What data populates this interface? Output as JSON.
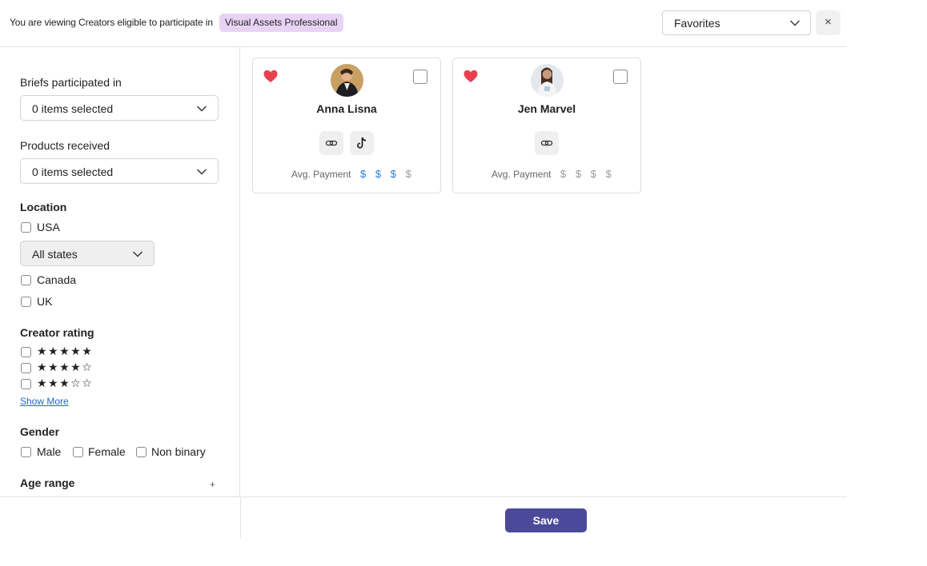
{
  "header": {
    "viewing_text": "You are viewing Creators eligible to participate in",
    "brief_pill": "Visual Assets Professional",
    "list_select_value": "Favorites",
    "close_symbol": "×",
    "pill_color": "#e9d3f5"
  },
  "filters": {
    "briefs": {
      "label": "Briefs participated in",
      "value": "0 items selected"
    },
    "products": {
      "label": "Products received",
      "value": "0 items selected"
    },
    "location": {
      "title": "Location",
      "usa": "USA",
      "states_value": "All states",
      "canada": "Canada",
      "uk": "UK"
    },
    "rating": {
      "title": "Creator rating",
      "rows": [
        {
          "stars": "★★★★★",
          "value": 5
        },
        {
          "stars": "★★★★☆",
          "value": 4
        },
        {
          "stars": "★★★☆☆",
          "value": 3
        }
      ],
      "show_more": "Show More"
    },
    "gender": {
      "title": "Gender",
      "male": "Male",
      "female": "Female",
      "non_binary": "Non binary"
    },
    "age": {
      "title": "Age range",
      "expand_symbol": "+"
    }
  },
  "creators": [
    {
      "name": "Anna Lisna",
      "favorited": true,
      "socials": [
        "link-icon",
        "tiktok-icon"
      ],
      "pay_label": "Avg. Payment",
      "pay_active": "$ $ $",
      "pay_inactive": "$",
      "pay_level": 3
    },
    {
      "name": "Jen Marvel",
      "favorited": true,
      "socials": [
        "link-icon"
      ],
      "pay_label": "Avg. Payment",
      "pay_active": "",
      "pay_inactive": "$ $ $ $",
      "pay_level": 0
    }
  ],
  "footer": {
    "save_label": "Save",
    "save_color": "#4b4a9a"
  },
  "colors": {
    "heart": "#e8404f",
    "pay_active": "#2a7ae2",
    "pay_inactive": "#9a9a9a"
  }
}
